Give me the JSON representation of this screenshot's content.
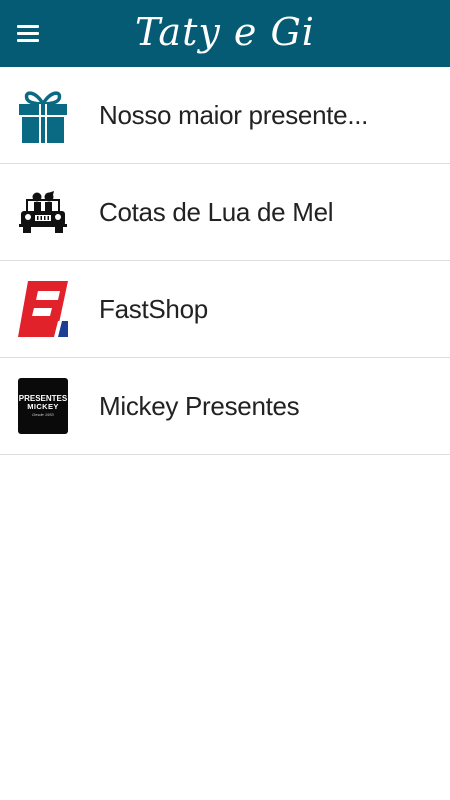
{
  "app_bar": {
    "title": "Taty e Gi",
    "menu_icon": "hamburger-menu-icon",
    "background": "#045b73"
  },
  "items": [
    {
      "label": "Nosso maior presente...",
      "icon": "gift-icon",
      "icon_color": "#0b6a83"
    },
    {
      "label": "Cotas de Lua de Mel",
      "icon": "car-couple-icon",
      "icon_color": "#111111"
    },
    {
      "label": "FastShop",
      "icon": "fastshop-logo-icon",
      "icon_colors": [
        "#e2222b",
        "#1c3f94"
      ]
    },
    {
      "label": "Mickey Presentes",
      "icon": "mickey-presentes-logo",
      "logo_lines": [
        "PRESENTES",
        "MICKEY",
        "Desde 1953"
      ]
    }
  ]
}
